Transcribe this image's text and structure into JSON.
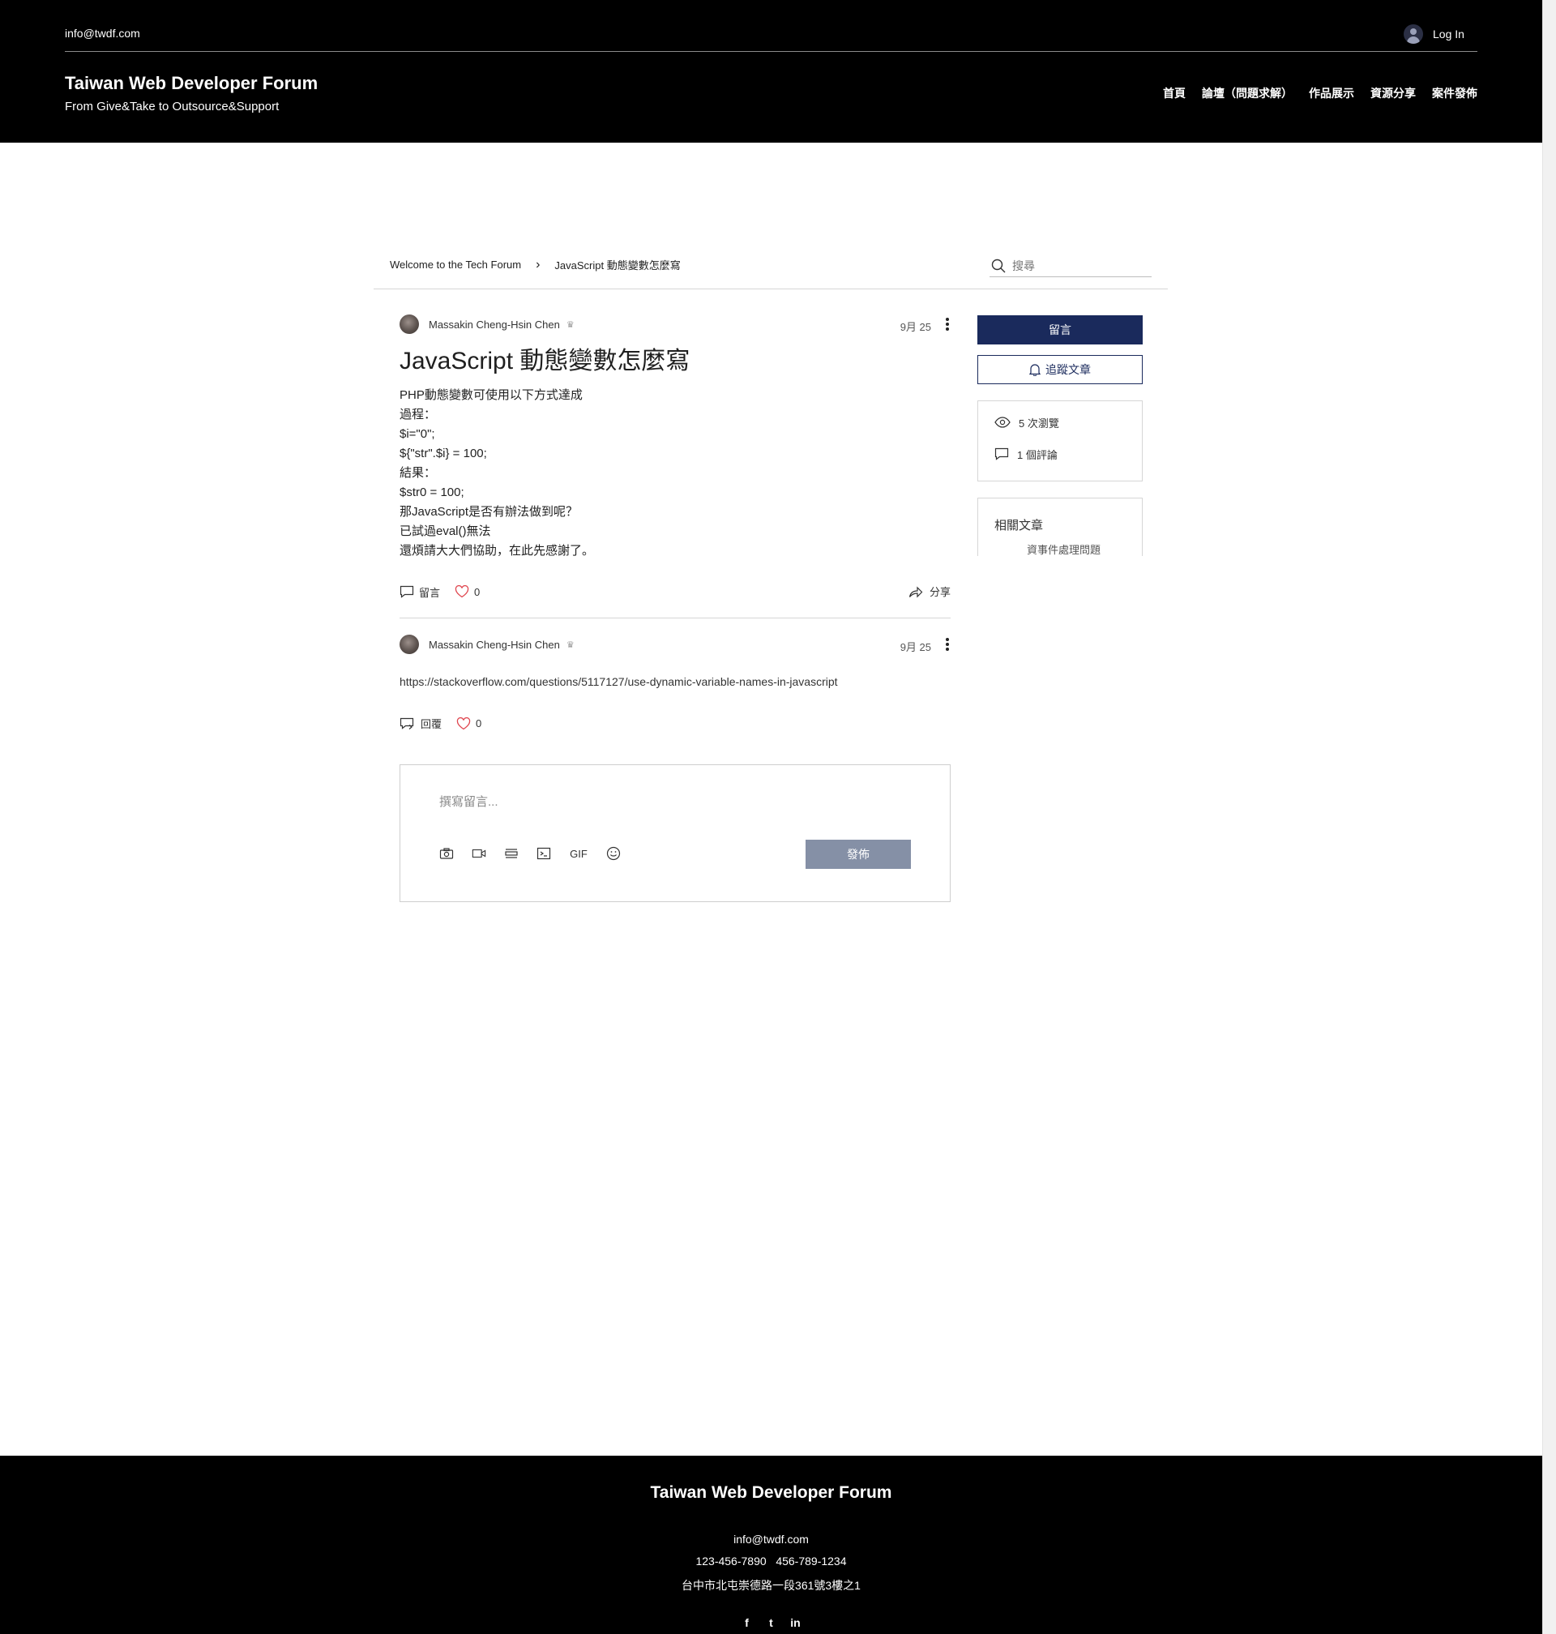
{
  "header": {
    "email": "info@twdf.com",
    "login_label": "Log In",
    "site_title": "Taiwan Web Developer Forum",
    "site_subtitle": "From Give&Take to Outsource&Support",
    "nav": [
      "首頁",
      "論壇（問題求解）",
      "作品展示",
      "資源分享",
      "案件發佈"
    ]
  },
  "breadcrumb": {
    "home": "Welcome to the Tech Forum",
    "current": "JavaScript 動態變數怎麼寫",
    "search_placeholder": "搜尋"
  },
  "post": {
    "author": "Massakin Cheng-Hsin Chen",
    "date": "9月 25",
    "title": "JavaScript 動態變數怎麼寫",
    "body": [
      "PHP動態變數可使用以下方式達成",
      "過程：",
      "$i=\"0\";",
      "${\"str\".$i} = 100;",
      "結果：",
      "$str0 = 100;",
      "那JavaScript是否有辦法做到呢？",
      "已試過eval()無法",
      "還煩請大大們協助，在此先感謝了。"
    ],
    "comment_label": "留言",
    "like_count": "0",
    "share_label": "分享"
  },
  "comment": {
    "author": "Massakin Cheng-Hsin Chen",
    "date": "9月 25",
    "text": "https://stackoverflow.com/questions/5117127/use-dynamic-variable-names-in-javascript",
    "reply_label": "回覆",
    "like_count": "0"
  },
  "editor": {
    "placeholder": "撰寫留言...",
    "gif_label": "GIF",
    "publish_label": "發佈"
  },
  "sidebar": {
    "comment_button": "留言",
    "follow_button": "追蹤文章",
    "views": "5 次瀏覽",
    "comments": "1 個評論",
    "related_title": "相關文章",
    "related_item": "資事件處理問題"
  },
  "footer": {
    "title": "Taiwan Web Developer Forum",
    "email": "info@twdf.com",
    "phones": "123-456-7890   456-789-1234",
    "address": "台中市北屯崇德路一段361號3樓之1",
    "social": [
      "f",
      "t",
      "in"
    ]
  }
}
